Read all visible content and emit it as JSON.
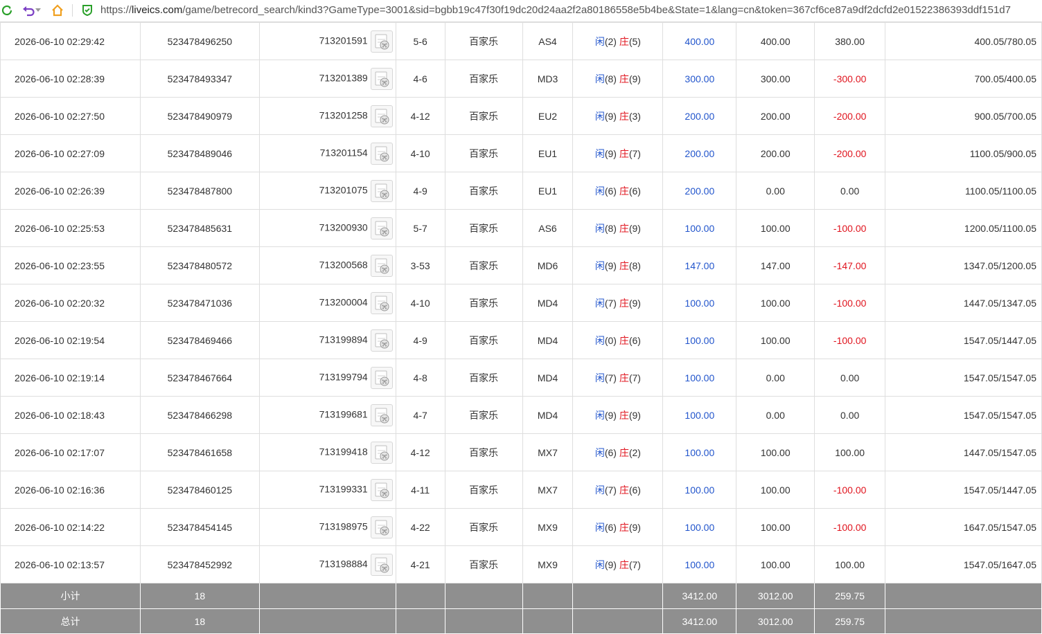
{
  "browser": {
    "url_prefix": "https://",
    "url_host": "liveics.com",
    "url_rest": "/game/betrecord_search/kind3?GameType=3001&sid=bgbb19c47f30f19dc20d24aa2f2a80186558e5b4be&State=1&lang=cn&token=367cf6ce87a9df2dcfd2e01522386393ddf151d7",
    "icons": [
      "refresh-icon",
      "undo-icon",
      "home-icon",
      "secure-shield-icon"
    ]
  },
  "colors": {
    "player": "#2255cc",
    "banker": "#e0141e",
    "negative": "#e0141e",
    "bet": "#2255cc",
    "summary_bg": "#8f8f8f"
  },
  "rows": [
    {
      "time": "2026-06-10 02:29:42",
      "order": "523478496250",
      "game": "713201591",
      "round": "5-6",
      "type": "百家乐",
      "table": "AS4",
      "p_label": "闲",
      "p_val": "(2)",
      "b_label": "庄",
      "b_val": "(5)",
      "bet": "400.00",
      "valid": "400.00",
      "win": "380.00",
      "win_neg": false,
      "balance": "400.05/780.05"
    },
    {
      "time": "2026-06-10 02:28:39",
      "order": "523478493347",
      "game": "713201389",
      "round": "4-6",
      "type": "百家乐",
      "table": "MD3",
      "p_label": "闲",
      "p_val": "(8)",
      "b_label": "庄",
      "b_val": "(9)",
      "bet": "300.00",
      "valid": "300.00",
      "win": "-300.00",
      "win_neg": true,
      "balance": "700.05/400.05"
    },
    {
      "time": "2026-06-10 02:27:50",
      "order": "523478490979",
      "game": "713201258",
      "round": "4-12",
      "type": "百家乐",
      "table": "EU2",
      "p_label": "闲",
      "p_val": "(9)",
      "b_label": "庄",
      "b_val": "(3)",
      "bet": "200.00",
      "valid": "200.00",
      "win": "-200.00",
      "win_neg": true,
      "balance": "900.05/700.05"
    },
    {
      "time": "2026-06-10 02:27:09",
      "order": "523478489046",
      "game": "713201154",
      "round": "4-10",
      "type": "百家乐",
      "table": "EU1",
      "p_label": "闲",
      "p_val": "(9)",
      "b_label": "庄",
      "b_val": "(7)",
      "bet": "200.00",
      "valid": "200.00",
      "win": "-200.00",
      "win_neg": true,
      "balance": "1100.05/900.05"
    },
    {
      "time": "2026-06-10 02:26:39",
      "order": "523478487800",
      "game": "713201075",
      "round": "4-9",
      "type": "百家乐",
      "table": "EU1",
      "p_label": "闲",
      "p_val": "(6)",
      "b_label": "庄",
      "b_val": "(6)",
      "bet": "200.00",
      "valid": "0.00",
      "win": "0.00",
      "win_neg": false,
      "balance": "1100.05/1100.05"
    },
    {
      "time": "2026-06-10 02:25:53",
      "order": "523478485631",
      "game": "713200930",
      "round": "5-7",
      "type": "百家乐",
      "table": "AS6",
      "p_label": "闲",
      "p_val": "(8)",
      "b_label": "庄",
      "b_val": "(9)",
      "bet": "100.00",
      "valid": "100.00",
      "win": "-100.00",
      "win_neg": true,
      "balance": "1200.05/1100.05"
    },
    {
      "time": "2026-06-10 02:23:55",
      "order": "523478480572",
      "game": "713200568",
      "round": "3-53",
      "type": "百家乐",
      "table": "MD6",
      "p_label": "闲",
      "p_val": "(9)",
      "b_label": "庄",
      "b_val": "(8)",
      "bet": "147.00",
      "valid": "147.00",
      "win": "-147.00",
      "win_neg": true,
      "balance": "1347.05/1200.05"
    },
    {
      "time": "2026-06-10 02:20:32",
      "order": "523478471036",
      "game": "713200004",
      "round": "4-10",
      "type": "百家乐",
      "table": "MD4",
      "p_label": "闲",
      "p_val": "(7)",
      "b_label": "庄",
      "b_val": "(9)",
      "bet": "100.00",
      "valid": "100.00",
      "win": "-100.00",
      "win_neg": true,
      "balance": "1447.05/1347.05"
    },
    {
      "time": "2026-06-10 02:19:54",
      "order": "523478469466",
      "game": "713199894",
      "round": "4-9",
      "type": "百家乐",
      "table": "MD4",
      "p_label": "闲",
      "p_val": "(0)",
      "b_label": "庄",
      "b_val": "(6)",
      "bet": "100.00",
      "valid": "100.00",
      "win": "-100.00",
      "win_neg": true,
      "balance": "1547.05/1447.05"
    },
    {
      "time": "2026-06-10 02:19:14",
      "order": "523478467664",
      "game": "713199794",
      "round": "4-8",
      "type": "百家乐",
      "table": "MD4",
      "p_label": "闲",
      "p_val": "(7)",
      "b_label": "庄",
      "b_val": "(7)",
      "bet": "100.00",
      "valid": "0.00",
      "win": "0.00",
      "win_neg": false,
      "balance": "1547.05/1547.05"
    },
    {
      "time": "2026-06-10 02:18:43",
      "order": "523478466298",
      "game": "713199681",
      "round": "4-7",
      "type": "百家乐",
      "table": "MD4",
      "p_label": "闲",
      "p_val": "(9)",
      "b_label": "庄",
      "b_val": "(9)",
      "bet": "100.00",
      "valid": "0.00",
      "win": "0.00",
      "win_neg": false,
      "balance": "1547.05/1547.05"
    },
    {
      "time": "2026-06-10 02:17:07",
      "order": "523478461658",
      "game": "713199418",
      "round": "4-12",
      "type": "百家乐",
      "table": "MX7",
      "p_label": "闲",
      "p_val": "(6)",
      "b_label": "庄",
      "b_val": "(2)",
      "bet": "100.00",
      "valid": "100.00",
      "win": "100.00",
      "win_neg": false,
      "balance": "1447.05/1547.05"
    },
    {
      "time": "2026-06-10 02:16:36",
      "order": "523478460125",
      "game": "713199331",
      "round": "4-11",
      "type": "百家乐",
      "table": "MX7",
      "p_label": "闲",
      "p_val": "(7)",
      "b_label": "庄",
      "b_val": "(6)",
      "bet": "100.00",
      "valid": "100.00",
      "win": "-100.00",
      "win_neg": true,
      "balance": "1547.05/1447.05"
    },
    {
      "time": "2026-06-10 02:14:22",
      "order": "523478454145",
      "game": "713198975",
      "round": "4-22",
      "type": "百家乐",
      "table": "MX9",
      "p_label": "闲",
      "p_val": "(6)",
      "b_label": "庄",
      "b_val": "(9)",
      "bet": "100.00",
      "valid": "100.00",
      "win": "-100.00",
      "win_neg": true,
      "balance": "1647.05/1547.05"
    },
    {
      "time": "2026-06-10 02:13:57",
      "order": "523478452992",
      "game": "713198884",
      "round": "4-21",
      "type": "百家乐",
      "table": "MX9",
      "p_label": "闲",
      "p_val": "(9)",
      "b_label": "庄",
      "b_val": "(7)",
      "bet": "100.00",
      "valid": "100.00",
      "win": "100.00",
      "win_neg": false,
      "balance": "1547.05/1647.05"
    }
  ],
  "summary": [
    {
      "label": "小计",
      "count": "18",
      "bet": "3412.00",
      "valid": "3012.00",
      "win": "259.75"
    },
    {
      "label": "总计",
      "count": "18",
      "bet": "3412.00",
      "valid": "3012.00",
      "win": "259.75"
    }
  ]
}
